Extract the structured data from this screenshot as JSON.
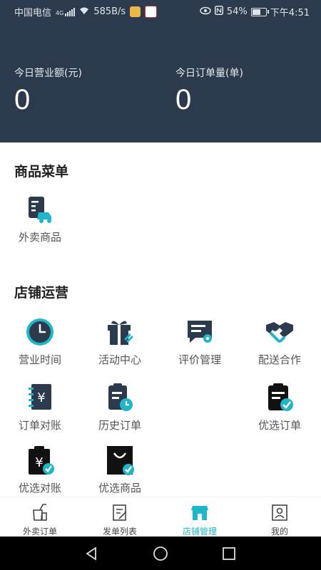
{
  "status": {
    "carrier": "中国电信",
    "net_type": "4G",
    "speed": "585B/s",
    "battery": "54%",
    "battery_level": 0.54,
    "time": "下午4:51"
  },
  "header": {
    "revenue_label": "今日营业额(元)",
    "revenue_value": "0",
    "orders_label": "今日订单量(单)",
    "orders_value": "0"
  },
  "menu_section": {
    "title": "商品菜单",
    "items": [
      {
        "label": "外卖商品",
        "icon": "takeout-goods-icon"
      }
    ]
  },
  "ops_section": {
    "title": "店铺运营",
    "items": [
      {
        "label": "营业时间",
        "icon": "clock-icon"
      },
      {
        "label": "活动中心",
        "icon": "gift-icon"
      },
      {
        "label": "评价管理",
        "icon": "review-icon"
      },
      {
        "label": "配送合作",
        "icon": "handshake-icon"
      },
      {
        "label": "订单对账",
        "icon": "yuan-ledger-icon"
      },
      {
        "label": "历史订单",
        "icon": "history-order-icon"
      },
      {
        "label": "优选订单",
        "icon": "preferred-order-icon"
      },
      {
        "label": "优选对账",
        "icon": "preferred-reconcile-icon"
      },
      {
        "label": "优选商品",
        "icon": "preferred-goods-icon"
      }
    ]
  },
  "tabbar": {
    "items": [
      {
        "label": "外卖订单",
        "icon": "takeout-order-icon",
        "active": false
      },
      {
        "label": "发单列表",
        "icon": "send-list-icon",
        "active": false
      },
      {
        "label": "店铺管理",
        "icon": "store-icon",
        "active": true
      },
      {
        "label": "我的",
        "icon": "profile-icon",
        "active": false
      }
    ]
  },
  "colors": {
    "header_bg": "#2c3a4d",
    "icon_dark": "#2c3a4d",
    "accent": "#1fb6c9"
  }
}
